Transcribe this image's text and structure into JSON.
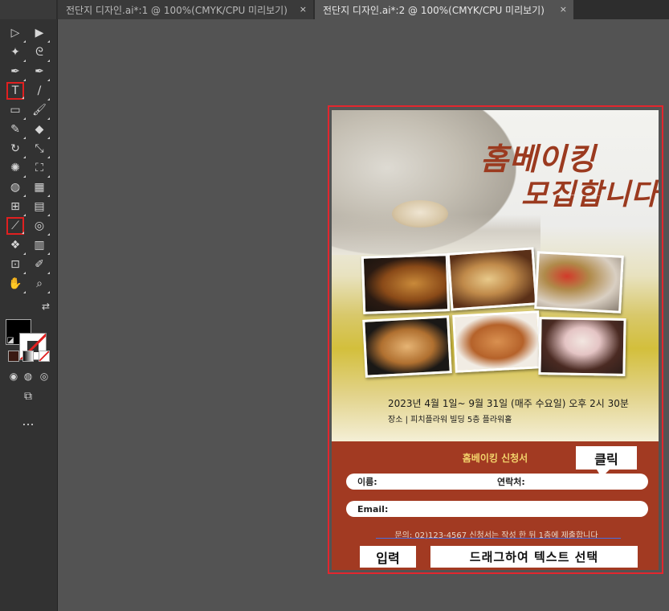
{
  "tabs": [
    {
      "label": "전단지 디자인.ai*:1 @ 100%(CMYK/CPU 미리보기)",
      "close": "×"
    },
    {
      "label": "전단지 디자인.ai*:2 @ 100%(CMYK/CPU 미리보기)",
      "close": "×"
    }
  ],
  "tools": [
    {
      "name": "selection-tool",
      "glyph": "▷"
    },
    {
      "name": "direct-selection-tool",
      "glyph": "▶"
    },
    {
      "name": "magic-wand-tool",
      "glyph": "✦"
    },
    {
      "name": "lasso-tool",
      "glyph": "ᘓ"
    },
    {
      "name": "pen-tool",
      "glyph": "✒"
    },
    {
      "name": "curvature-tool",
      "glyph": "✒"
    },
    {
      "name": "type-tool",
      "glyph": "T"
    },
    {
      "name": "line-tool",
      "glyph": "/"
    },
    {
      "name": "rectangle-tool",
      "glyph": "▭"
    },
    {
      "name": "paintbrush-tool",
      "glyph": "🖌"
    },
    {
      "name": "shaper-tool",
      "glyph": "✎"
    },
    {
      "name": "eraser-tool",
      "glyph": "◆"
    },
    {
      "name": "rotate-tool",
      "glyph": "↻"
    },
    {
      "name": "scale-tool",
      "glyph": "⤡"
    },
    {
      "name": "warp-tool",
      "glyph": "✺"
    },
    {
      "name": "free-transform-tool",
      "glyph": "⛶"
    },
    {
      "name": "shape-builder-tool",
      "glyph": "◍"
    },
    {
      "name": "perspective-grid-tool",
      "glyph": "▦"
    },
    {
      "name": "mesh-tool",
      "glyph": "⊞"
    },
    {
      "name": "gradient-tool",
      "glyph": "▤"
    },
    {
      "name": "eyedropper-tool",
      "glyph": "⟋"
    },
    {
      "name": "blend-tool",
      "glyph": "◎"
    },
    {
      "name": "symbol-sprayer-tool",
      "glyph": "❖"
    },
    {
      "name": "column-graph-tool",
      "glyph": "▥"
    },
    {
      "name": "artboard-tool",
      "glyph": "⊡"
    },
    {
      "name": "slice-tool",
      "glyph": "✐"
    },
    {
      "name": "hand-tool",
      "glyph": "✋"
    },
    {
      "name": "zoom-tool",
      "glyph": "⌕"
    }
  ],
  "more_tools": "...",
  "poster": {
    "title_line1": "홈베이킹",
    "title_line2": "모집합니다",
    "date_line": "2023년 4월 1일~ 9월 31일 (매주 수요일) 오후 2시 30분",
    "place_line": "장소 | 피치플라워 빌딩 5층 플라워홀",
    "form_title": "홈베이킹 신청서",
    "name_label": "이름:",
    "contact_label": "연락처:",
    "email_label": "Email:",
    "notice": "문의: 02)123-4567 신청서는 작성 한 뒤 1층에 제출합니다"
  },
  "annotations": {
    "click": "클릭",
    "input": "입력",
    "drag": "드래그하여 텍스트 선택"
  },
  "colors": {
    "selection_red": "#e3262e",
    "poster_title": "#9b3a1f",
    "form_bg": "#a23a22",
    "form_title": "#f3d36b"
  }
}
